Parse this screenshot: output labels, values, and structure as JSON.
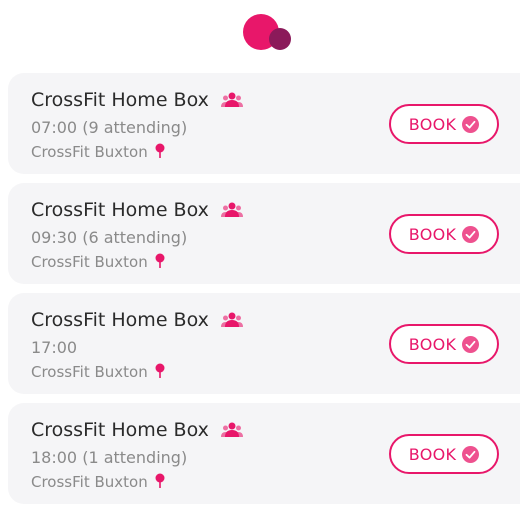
{
  "colors": {
    "accent": "#e8176a",
    "logo_dot": "#8b1a5a",
    "card_bg": "#f5f5f7",
    "title_text": "#2b2b2b",
    "secondary_text": "#8a8a8a"
  },
  "icons": {
    "logo": "brand-logo-icon",
    "attendees": "people-icon",
    "location": "map-pin-icon",
    "book_check": "check-circle-icon"
  },
  "classes": [
    {
      "name": "CrossFit Home Box",
      "time": "07:00 (9 attending)",
      "location": "CrossFit Buxton",
      "book_label": "BOOK"
    },
    {
      "name": "CrossFit Home Box",
      "time": "09:30 (6 attending)",
      "location": "CrossFit Buxton",
      "book_label": "BOOK"
    },
    {
      "name": "CrossFit Home Box",
      "time": "17:00",
      "location": "CrossFit Buxton",
      "book_label": "BOOK"
    },
    {
      "name": "CrossFit Home Box",
      "time": "18:00 (1 attending)",
      "location": "CrossFit Buxton",
      "book_label": "BOOK"
    }
  ]
}
